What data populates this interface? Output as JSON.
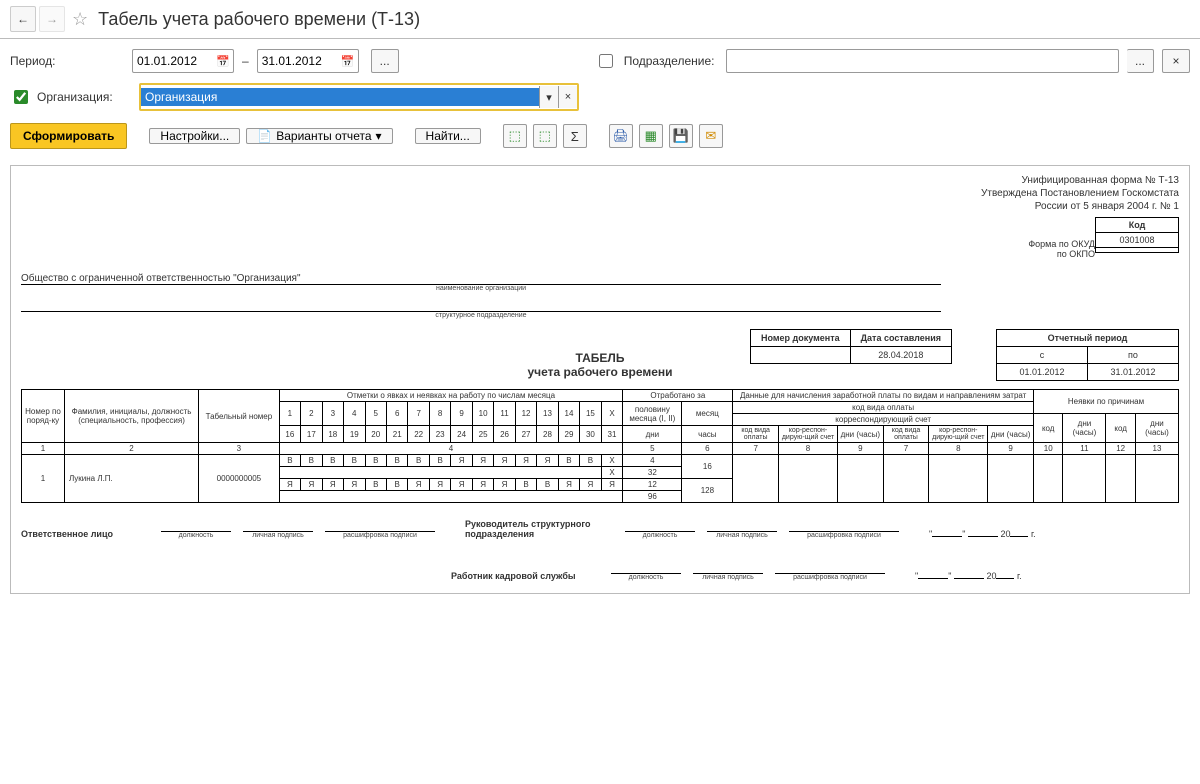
{
  "header": {
    "title": "Табель учета рабочего времени (Т-13)"
  },
  "period": {
    "label": "Период:",
    "from": "01.01.2012",
    "to": "31.01.2012",
    "dash": "–",
    "more": "..."
  },
  "dept": {
    "label": "Подразделение:",
    "value": "",
    "more": "...",
    "clear": "×"
  },
  "org": {
    "checked": true,
    "label": "Организация:",
    "value": "Организация",
    "dd": "▾",
    "clear": "×"
  },
  "toolbar": {
    "generate": "Сформировать",
    "settings": "Настройки...",
    "variants": "Варианты отчета",
    "find": "Найти..."
  },
  "form": {
    "approval1": "Унифицированная форма № Т-13",
    "approval2": "Утверждена Постановлением Госкомстата",
    "approval3": "России от 5 января 2004 г. № 1",
    "codeLabel": "Код",
    "okudLabel": "Форма по ОКУД",
    "okud": "0301008",
    "okpoLabel": "по ОКПО",
    "okpo": "",
    "orgFull": "Общество с ограниченной ответственностью \"Организация\"",
    "orgCaption": "наименование организации",
    "deptCaption": "структурное подразделение",
    "title1": "ТАБЕЛЬ",
    "title2": "учета  рабочего  времени",
    "docNoHdr": "Номер документа",
    "docDateHdr": "Дата составления",
    "docNo": "",
    "docDate": "28.04.2018",
    "repPeriodHdr": "Отчетный период",
    "from": "с",
    "to": "по",
    "repFrom": "01.01.2012",
    "repTo": "31.01.2012"
  },
  "gridHdr": {
    "c1": "Номер по поряд-ку",
    "c2": "Фамилия, инициалы, должность (специальность, профессия)",
    "c3": "Табельный номер",
    "c4": "Отметки о явках и неявках на работу по числам месяца",
    "c5": "Отработано за",
    "half": "половину месяца (I, II)",
    "month": "месяц",
    "days": "дни",
    "hours": "часы",
    "salary": "Данные для начисления заработной платы по видам и направлениям затрат",
    "payCode": "код вида оплаты",
    "corAcc": "корреспондирующий счет",
    "absences": "Неявки по причинам",
    "code": "код",
    "daysH": "дни (часы)"
  },
  "colnums": {
    "n1": "1",
    "n2": "2",
    "n3": "3",
    "n4": "4",
    "n5": "5",
    "n6": "6",
    "n7": "7",
    "n8": "8",
    "n9": "9",
    "n10": "10",
    "n11": "11",
    "n12": "12",
    "n13": "13"
  },
  "daysRow1": [
    "1",
    "2",
    "3",
    "4",
    "5",
    "6",
    "7",
    "8",
    "9",
    "10",
    "11",
    "12",
    "13",
    "14",
    "15",
    "Х"
  ],
  "daysRow2": [
    "16",
    "17",
    "18",
    "19",
    "20",
    "21",
    "22",
    "23",
    "24",
    "25",
    "26",
    "27",
    "28",
    "29",
    "30",
    "31"
  ],
  "row": {
    "num": "1",
    "name": "Лукина  Л.П.",
    "tabNo": "0000000005",
    "marks1": [
      "В",
      "В",
      "В",
      "В",
      "В",
      "В",
      "В",
      "В",
      "Я",
      "Я",
      "Я",
      "Я",
      "Я",
      "В",
      "В",
      "Х"
    ],
    "marks2": [
      "Я",
      "Я",
      "Я",
      "Я",
      "В",
      "В",
      "Я",
      "Я",
      "Я",
      "Я",
      "Я",
      "В",
      "В",
      "Я",
      "Я",
      "Я"
    ],
    "worked": {
      "halfDays": "4",
      "monthDays": "16",
      "halfX": "Х",
      "halfHours": "32",
      "fullDays": "12",
      "fullHours": "96",
      "monthHours": "128"
    }
  },
  "footer": {
    "respLbl": "Ответственное лицо",
    "chiefLbl": "Руководитель структурного подразделения",
    "hrLbl": "Работник кадровой службы",
    "position": "должность",
    "sign": "личная подпись",
    "transcript": "расшифровка подписи",
    "yr": "20",
    "g": "г.",
    "q": "\""
  }
}
